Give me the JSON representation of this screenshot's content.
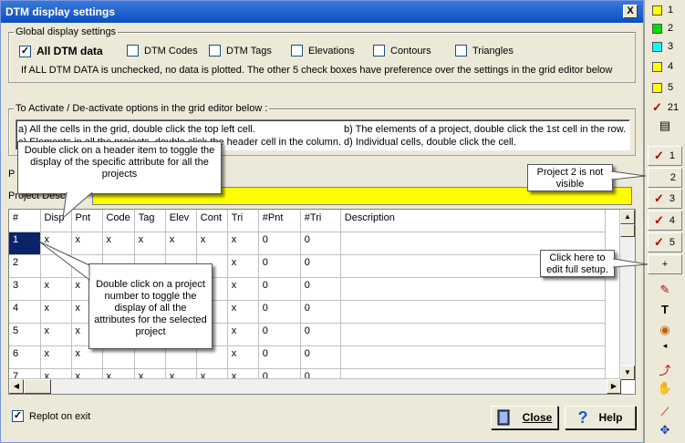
{
  "dialog": {
    "title": "DTM display settings",
    "close_glyph": "X"
  },
  "global": {
    "label": "Global display settings",
    "checkboxes": [
      {
        "label": "All DTM data",
        "checked": true
      },
      {
        "label": "DTM Codes",
        "checked": false
      },
      {
        "label": "DTM Tags",
        "checked": false
      },
      {
        "label": "Elevations",
        "checked": false
      },
      {
        "label": "Contours",
        "checked": false
      },
      {
        "label": "Triangles",
        "checked": false
      }
    ],
    "note": "If ALL DTM DATA is unchecked, no data is plotted. The other 5 check boxes have preference over the settings in the grid editor below"
  },
  "activate": {
    "label": "To Activate / De-activate options in the grid editor below :",
    "line_a": "a) All the cells in the grid, double click the top left cell.",
    "line_b": "b) The elements of a project, double click the 1st cell in the row.",
    "line_c": "c) Elements in all the projects, double click the header cell in the column.",
    "line_d": "d) Individual cells, double click the cell."
  },
  "callouts": {
    "header": "Double click on a header item to toggle the display of the specific attribute for all the projects",
    "project": "Double click on  a project number to toggle the display of all the attributes for the selected project",
    "project2": "Project 2 is not visible",
    "plus": "Click here to edit full setup."
  },
  "project": {
    "label_visible": "P",
    "desc_label": "Project Desc"
  },
  "grid": {
    "headers": [
      "#",
      "Disp",
      "Pnt",
      "Code",
      "Tag",
      "Elev",
      "Cont",
      "Tri",
      "#Pnt",
      "#Tri",
      "Description"
    ],
    "rows": [
      [
        "1",
        "x",
        "x",
        "x",
        "x",
        "x",
        "x",
        "x",
        "0",
        "0",
        ""
      ],
      [
        "2",
        "",
        "",
        "",
        "",
        "",
        "",
        "x",
        "0",
        "0",
        ""
      ],
      [
        "3",
        "x",
        "x",
        "",
        "",
        "",
        "",
        "x",
        "0",
        "0",
        ""
      ],
      [
        "4",
        "x",
        "x",
        "",
        "",
        "",
        "",
        "x",
        "0",
        "0",
        ""
      ],
      [
        "5",
        "x",
        "x",
        "",
        "",
        "",
        "",
        "x",
        "0",
        "0",
        ""
      ],
      [
        "6",
        "x",
        "x",
        "",
        "",
        "",
        "",
        "x",
        "0",
        "0",
        ""
      ],
      [
        "7",
        "x",
        "x",
        "x",
        "x",
        "x",
        "x",
        "x",
        "0",
        "0",
        ""
      ]
    ]
  },
  "footer": {
    "replot_label": "Replot on exit",
    "replot_checked": true,
    "close_label": "Close",
    "help_label": "Help"
  },
  "toolbar": {
    "layers": [
      {
        "label": "1",
        "color": "#ffff00"
      },
      {
        "label": "2",
        "color": "#00e000"
      },
      {
        "label": "3",
        "color": "#00ffff"
      },
      {
        "label": "4",
        "color": "#ffff00"
      },
      {
        "label": "5",
        "color": "#ffff00"
      }
    ],
    "all_label": "21",
    "projects": [
      {
        "label": "1",
        "checked": true
      },
      {
        "label": "2",
        "checked": false
      },
      {
        "label": "3",
        "checked": true
      },
      {
        "label": "4",
        "checked": true
      },
      {
        "label": "5",
        "checked": true
      }
    ],
    "plus_label": "+"
  }
}
